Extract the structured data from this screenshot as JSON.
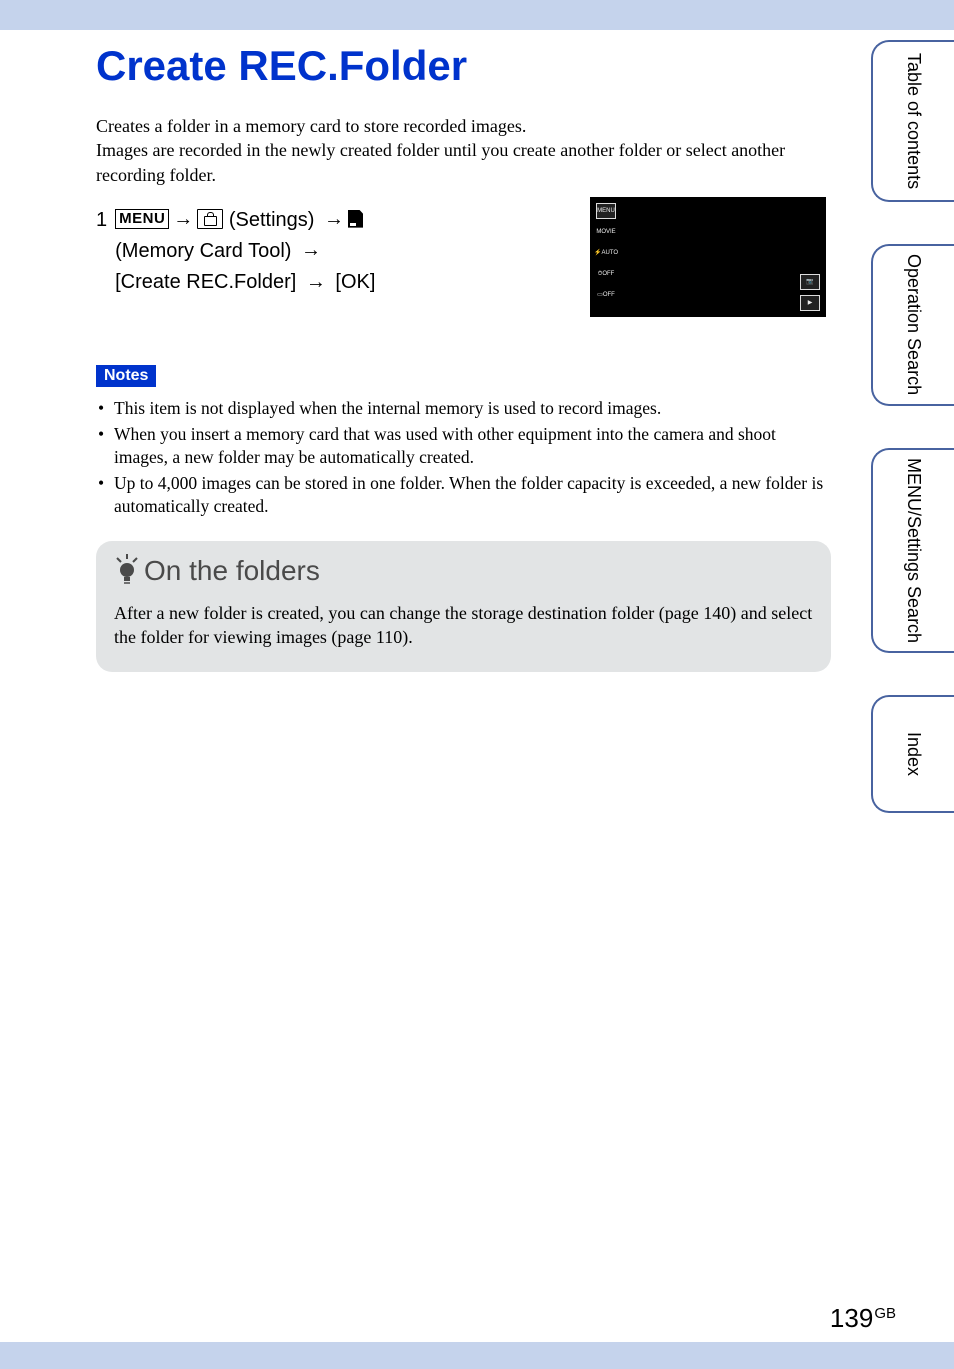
{
  "page": {
    "title": "Create REC.Folder",
    "intro": "Creates a folder in a memory card to store recorded images.\nImages are recorded in the newly created folder until you create another folder or select another recording folder.",
    "step": {
      "number": "1",
      "menu_label": "MENU",
      "settings_label": " (Settings) ",
      "tool_label": " (Memory Card Tool) ",
      "create_label": " [Create REC.Folder] ",
      "ok_label": " [OK]",
      "arrow": "→"
    },
    "notes_heading": "Notes",
    "notes": [
      "This item is not displayed when the internal memory is used to record images.",
      "When you insert a memory card that was used with other equipment into the camera and shoot images, a new folder may be automatically created.",
      "Up to 4,000 images can be stored in one folder. When the folder capacity is exceeded, a new folder is automatically created."
    ],
    "tip": {
      "heading": "On the folders",
      "body": "After a new folder is created, you can change the storage destination folder (page 140) and select the folder for viewing images (page 110)."
    },
    "page_number": "139",
    "page_suffix": "GB"
  },
  "side_tabs": [
    "Table of contents",
    "Operation Search",
    "MENU/Settings Search",
    "Index"
  ],
  "thumb_icons_left": [
    "MENU",
    "MOVIE",
    "⚡AUTO",
    "⏱OFF",
    "▭OFF"
  ],
  "thumb_icons_right": [
    "📷",
    "▶"
  ]
}
